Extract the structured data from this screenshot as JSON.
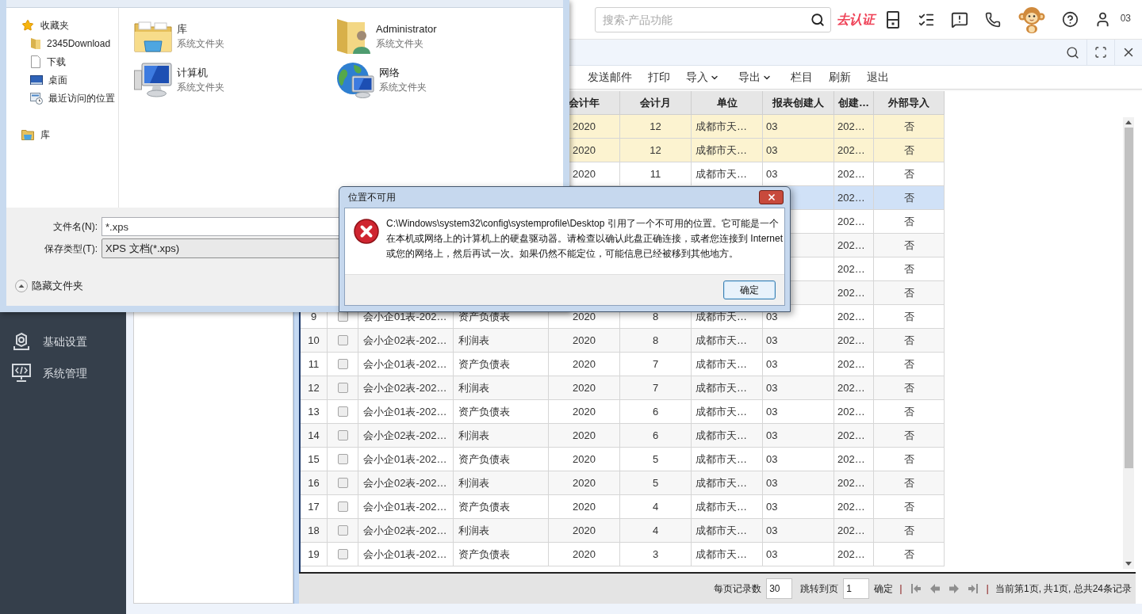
{
  "save_dialog": {
    "nav": [
      {
        "label": "收藏夹",
        "kind": "star",
        "children": [
          {
            "label": "2345Download",
            "kind": "folder"
          },
          {
            "label": "下载",
            "kind": "document"
          },
          {
            "label": "桌面",
            "kind": "desktop"
          },
          {
            "label": "最近访问的位置",
            "kind": "recent"
          }
        ]
      },
      {
        "label": "库",
        "kind": "library"
      }
    ],
    "items": [
      {
        "name": "库",
        "type": "系统文件夹",
        "kind": "library"
      },
      {
        "name": "Administrator",
        "type": "系统文件夹",
        "kind": "user"
      },
      {
        "name": "计算机",
        "type": "系统文件夹",
        "kind": "computer"
      },
      {
        "name": "网络",
        "type": "系统文件夹",
        "kind": "network"
      }
    ],
    "file_name": {
      "label": "文件名(N):",
      "value": "*.xps"
    },
    "save_type": {
      "label": "保存类型(T):",
      "value": "XPS 文档(*.xps)"
    },
    "hide_folders": "隐藏文件夹"
  },
  "error_dialog": {
    "title": "位置不可用",
    "message": "C:\\Windows\\system32\\config\\systemprofile\\Desktop 引用了一个不可用的位置。它可能是一个在本机或网络上的计算机上的硬盘驱动器。请检查以确认此盘正确连接，或者您连接到 Internet 或您的网络上，然后再试一次。如果仍然不能定位，可能信息已经被移到其他地方。",
    "buttons": [
      "确定"
    ]
  },
  "header": {
    "search": {
      "placeholder": "搜索-产品功能"
    },
    "verify_link": "去认证",
    "user_name": "03"
  },
  "sidebar": {
    "items": [
      {
        "label": "基础设置",
        "kind": "settings"
      },
      {
        "label": "系统管理",
        "kind": "system"
      }
    ]
  },
  "toolbar": {
    "buttons": [
      {
        "label": "发送邮件",
        "kind": "button"
      },
      {
        "label": "打印",
        "kind": "button"
      },
      {
        "label": "导入",
        "kind": "dropdown"
      },
      {
        "label": "导出",
        "kind": "dropdown"
      },
      {
        "label": "栏目",
        "kind": "button"
      },
      {
        "label": "刷新",
        "kind": "button"
      },
      {
        "label": "退出",
        "kind": "button"
      }
    ]
  },
  "table": {
    "columns": [
      "会计年",
      "会计月",
      "单位",
      "报表创建人",
      "创建…",
      "外部导入"
    ],
    "rows": [
      {
        "year": "2020",
        "month": "12",
        "unit": "成都市天…",
        "creator": "03",
        "created": "202…",
        "imported": "否",
        "highlighted": true,
        "selected": false
      },
      {
        "year": "2020",
        "month": "12",
        "unit": "成都市天…",
        "creator": "03",
        "created": "202…",
        "imported": "否",
        "highlighted": true,
        "selected": false
      },
      {
        "year": "2020",
        "month": "11",
        "unit": "成都市天…",
        "creator": "03",
        "created": "202…",
        "imported": "否",
        "highlighted": false,
        "selected": false
      },
      {
        "created": "202…",
        "imported": "否",
        "highlighted": false,
        "selected": true
      },
      {
        "created": "202…",
        "imported": "否",
        "highlighted": false,
        "selected": false
      },
      {
        "created": "202…",
        "imported": "否",
        "highlighted": false,
        "selected": false
      },
      {
        "created": "202…",
        "imported": "否",
        "highlighted": false,
        "selected": false
      },
      {
        "created": "202…",
        "imported": "否",
        "highlighted": false,
        "selected": false
      },
      {
        "no": "9",
        "checked": false,
        "name": "会小企01表-202…",
        "type": "资产负债表",
        "year": "2020",
        "month": "8",
        "unit": "成都市天…",
        "creator": "03",
        "created": "202…",
        "imported": "否",
        "highlighted": false,
        "selected": false
      },
      {
        "no": "10",
        "checked": false,
        "name": "会小企02表-202…",
        "type": "利润表",
        "year": "2020",
        "month": "8",
        "unit": "成都市天…",
        "creator": "03",
        "created": "202…",
        "imported": "否",
        "highlighted": false,
        "selected": false
      },
      {
        "no": "11",
        "checked": false,
        "name": "会小企01表-202…",
        "type": "资产负债表",
        "year": "2020",
        "month": "7",
        "unit": "成都市天…",
        "creator": "03",
        "created": "202…",
        "imported": "否",
        "highlighted": false,
        "selected": false
      },
      {
        "no": "12",
        "checked": false,
        "name": "会小企02表-202…",
        "type": "利润表",
        "year": "2020",
        "month": "7",
        "unit": "成都市天…",
        "creator": "03",
        "created": "202…",
        "imported": "否",
        "highlighted": false,
        "selected": false
      },
      {
        "no": "13",
        "checked": false,
        "name": "会小企01表-202…",
        "type": "资产负债表",
        "year": "2020",
        "month": "6",
        "unit": "成都市天…",
        "creator": "03",
        "created": "202…",
        "imported": "否",
        "highlighted": false,
        "selected": false
      },
      {
        "no": "14",
        "checked": false,
        "name": "会小企02表-202…",
        "type": "利润表",
        "year": "2020",
        "month": "6",
        "unit": "成都市天…",
        "creator": "03",
        "created": "202…",
        "imported": "否",
        "highlighted": false,
        "selected": false
      },
      {
        "no": "15",
        "checked": false,
        "name": "会小企01表-202…",
        "type": "资产负债表",
        "year": "2020",
        "month": "5",
        "unit": "成都市天…",
        "creator": "03",
        "created": "202…",
        "imported": "否",
        "highlighted": false,
        "selected": false
      },
      {
        "no": "16",
        "checked": false,
        "name": "会小企02表-202…",
        "type": "利润表",
        "year": "2020",
        "month": "5",
        "unit": "成都市天…",
        "creator": "03",
        "created": "202…",
        "imported": "否",
        "highlighted": false,
        "selected": false
      },
      {
        "no": "17",
        "checked": false,
        "name": "会小企01表-202…",
        "type": "资产负债表",
        "year": "2020",
        "month": "4",
        "unit": "成都市天…",
        "creator": "03",
        "created": "202…",
        "imported": "否",
        "highlighted": false,
        "selected": false
      },
      {
        "no": "18",
        "checked": false,
        "name": "会小企02表-202…",
        "type": "利润表",
        "year": "2020",
        "month": "4",
        "unit": "成都市天…",
        "creator": "03",
        "created": "202…",
        "imported": "否",
        "highlighted": false,
        "selected": false
      },
      {
        "no": "19",
        "checked": false,
        "name": "会小企01表-202…",
        "type": "资产负债表",
        "year": "2020",
        "month": "3",
        "unit": "成都市天…",
        "creator": "03",
        "created": "202…",
        "imported": "否",
        "highlighted": false,
        "selected": false
      }
    ]
  },
  "pagination": {
    "page_size_label": "每页记录数",
    "page_size": "30",
    "jump_label": "跳转到页",
    "page": "1",
    "confirm": "确定",
    "controls": [
      {
        "kind": "separator",
        "text": "|"
      },
      {
        "kind": "first"
      },
      {
        "kind": "prev"
      },
      {
        "kind": "next"
      },
      {
        "kind": "last"
      },
      {
        "kind": "separator",
        "text": "|"
      }
    ],
    "summary": "当前第1页, 共1页, 总共24条记录"
  }
}
